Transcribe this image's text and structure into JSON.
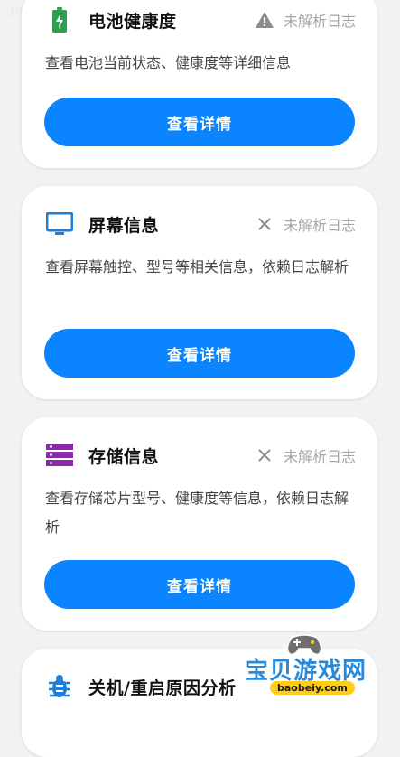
{
  "status_bar": {
    "time": "10"
  },
  "cards": [
    {
      "title": "电池健康度",
      "icon": "battery-charging-icon",
      "status_icon": "warning-icon",
      "status": "未解析日志",
      "description": "查看电池当前状态、健康度等详细信息",
      "button": "查看详情",
      "accent": "#2e9e4f"
    },
    {
      "title": "屏幕信息",
      "icon": "monitor-icon",
      "status_icon": "close-icon",
      "status": "未解析日志",
      "description": "查看屏幕触控、型号等相关信息，依赖日志解析",
      "button": "查看详情",
      "accent": "#1e7fd8"
    },
    {
      "title": "存储信息",
      "icon": "storage-icon",
      "status_icon": "close-icon",
      "status": "未解析日志",
      "description": "查看存储芯片型号、健康度等信息，依赖日志解析",
      "button": "查看详情",
      "accent": "#8a2aa6"
    },
    {
      "title": "关机/重启原因分析",
      "icon": "bug-icon",
      "accent": "#1e7fd8"
    }
  ],
  "watermark": {
    "logo": "宝贝游戏网",
    "url": "baobeiy.com"
  },
  "colors": {
    "primary_button": "#0a84ff",
    "background": "#f2f2f2",
    "status_text": "#a6a6a6"
  }
}
